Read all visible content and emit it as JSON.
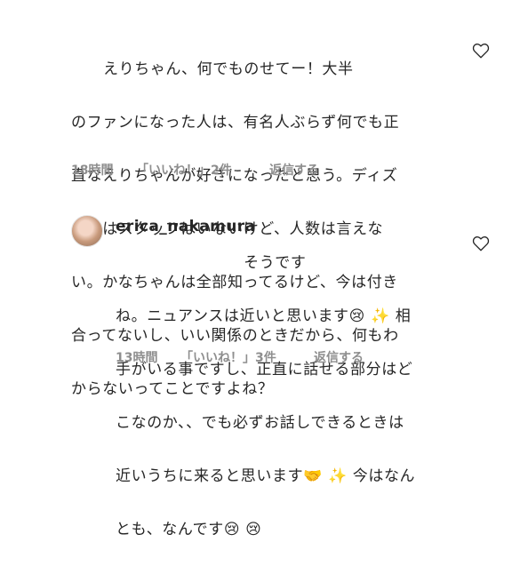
{
  "comment1": {
    "lines": [
      "      えりちゃん、何でものせてー！大半",
      "のファンになった人は、有名人ぶらず何でも正",
      "直なえりちゃんが好きになったと思う。ディズ",
      "ニーはスタッフはいないけど、人数は言えな",
      "い。かなちゃんは全部知ってるけど、今は付き",
      "合ってないし、いい関係のときだから、何もわ",
      "からないってことですよね？"
    ],
    "time": "18時間",
    "likes": "「いいね！」2件",
    "reply": "返信する"
  },
  "comment2": {
    "username": "erica_nakamura",
    "lines": [
      "                        そうです",
      "ね。ニュアンスは近いと思います😢 ✨ 相",
      "手がいる事ですし、正直に話せる部分はど",
      "こなのか、、でも必ずお話しできるときは",
      "近いうちに来ると思います🤝 ✨ 今はなん",
      "とも、なんです😢 😢"
    ],
    "time": "13時間",
    "likes": "「いいね！」3件",
    "reply": "返信する"
  },
  "icons": {
    "like": "heart-outline-icon",
    "avatar": "profile-avatar"
  },
  "colors": {
    "text": "#262626",
    "meta": "#8e8e8e"
  }
}
